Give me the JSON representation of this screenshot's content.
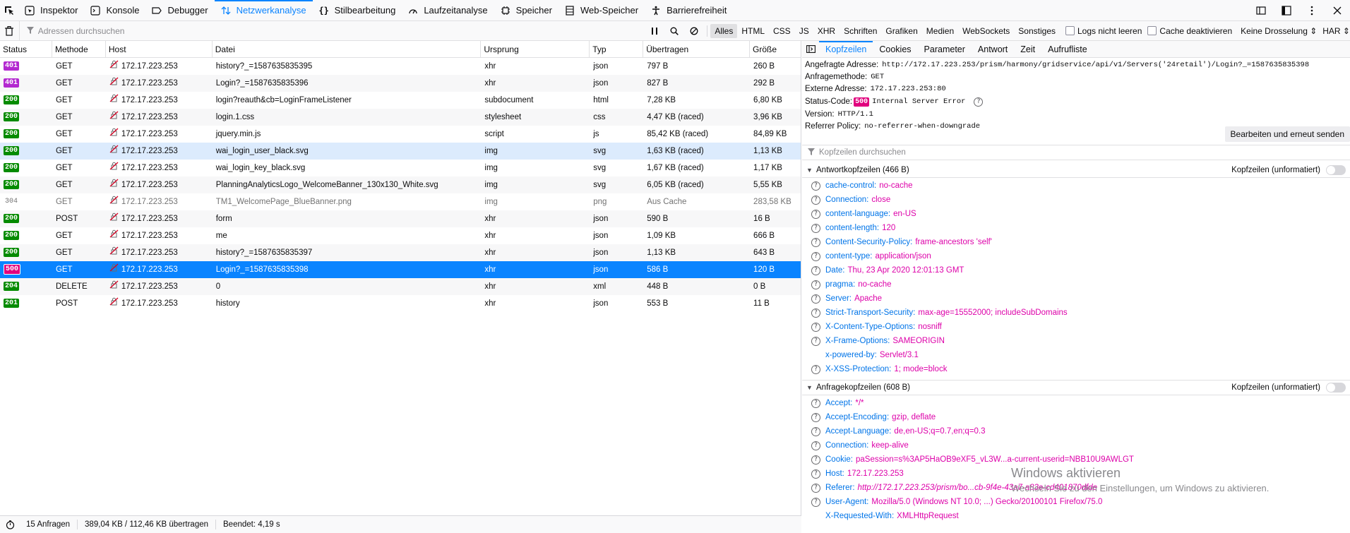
{
  "toolbar": {
    "tabs": [
      {
        "label": "Inspektor",
        "icon": "inspector-icon"
      },
      {
        "label": "Konsole",
        "icon": "console-icon"
      },
      {
        "label": "Debugger",
        "icon": "debugger-icon"
      },
      {
        "label": "Netzwerkanalyse",
        "icon": "network-icon",
        "selected": true
      },
      {
        "label": "Stilbearbeitung",
        "icon": "style-editor-icon"
      },
      {
        "label": "Laufzeitanalyse",
        "icon": "performance-icon"
      },
      {
        "label": "Speicher",
        "icon": "memory-icon"
      },
      {
        "label": "Web-Speicher",
        "icon": "storage-icon"
      },
      {
        "label": "Barrierefreiheit",
        "icon": "accessibility-icon"
      }
    ]
  },
  "filterbar": {
    "placeholder": "Adressen durchsuchen",
    "types": [
      "Alles",
      "HTML",
      "CSS",
      "JS",
      "XHR",
      "Schriften",
      "Grafiken",
      "Medien",
      "WebSockets",
      "Sonstiges"
    ],
    "active_type": "Alles",
    "persist_logs": "Logs nicht leeren",
    "disable_cache": "Cache deaktivieren",
    "throttling": "Keine Drosselung ⇕",
    "har": "HAR ⇕"
  },
  "table": {
    "columns": [
      "Status",
      "Methode",
      "Host",
      "Datei",
      "Ursprung",
      "Typ",
      "Übertragen",
      "Größe"
    ],
    "rows": [
      {
        "status": "401",
        "method": "GET",
        "host": "172.17.223.253",
        "file": "history?_=1587635835395",
        "origin": "xhr",
        "type": "json",
        "transferred": "797 B",
        "size": "260 B"
      },
      {
        "status": "401",
        "method": "GET",
        "host": "172.17.223.253",
        "file": "Login?_=1587635835396",
        "origin": "xhr",
        "type": "json",
        "transferred": "827 B",
        "size": "292 B"
      },
      {
        "status": "200",
        "method": "GET",
        "host": "172.17.223.253",
        "file": "login?reauth&cb=LoginFrameListener",
        "origin": "subdocument",
        "type": "html",
        "transferred": "7,28 KB",
        "size": "6,80 KB"
      },
      {
        "status": "200",
        "method": "GET",
        "host": "172.17.223.253",
        "file": "login.1.css",
        "origin": "stylesheet",
        "type": "css",
        "transferred": "4,47 KB (raced)",
        "size": "3,96 KB"
      },
      {
        "status": "200",
        "method": "GET",
        "host": "172.17.223.253",
        "file": "jquery.min.js",
        "origin": "script",
        "type": "js",
        "transferred": "85,42 KB (raced)",
        "size": "84,89 KB"
      },
      {
        "status": "200",
        "method": "GET",
        "host": "172.17.223.253",
        "file": "wai_login_user_black.svg",
        "origin": "img",
        "type": "svg",
        "transferred": "1,63 KB (raced)",
        "size": "1,13 KB",
        "highlight": true
      },
      {
        "status": "200",
        "method": "GET",
        "host": "172.17.223.253",
        "file": "wai_login_key_black.svg",
        "origin": "img",
        "type": "svg",
        "transferred": "1,67 KB (raced)",
        "size": "1,17 KB"
      },
      {
        "status": "200",
        "method": "GET",
        "host": "172.17.223.253",
        "file": "PlanningAnalyticsLogo_WelcomeBanner_130x130_White.svg",
        "origin": "img",
        "type": "svg",
        "transferred": "6,05 KB (raced)",
        "size": "5,55 KB"
      },
      {
        "status": "304",
        "method": "GET",
        "host": "172.17.223.253",
        "file": "TM1_WelcomePage_BlueBanner.png",
        "origin": "img",
        "type": "png",
        "transferred": "Aus Cache",
        "size": "283,58 KB",
        "cached": true
      },
      {
        "status": "200",
        "method": "POST",
        "host": "172.17.223.253",
        "file": "form",
        "origin": "xhr",
        "type": "json",
        "transferred": "590 B",
        "size": "16 B"
      },
      {
        "status": "200",
        "method": "GET",
        "host": "172.17.223.253",
        "file": "me",
        "origin": "xhr",
        "type": "json",
        "transferred": "1,09 KB",
        "size": "666 B"
      },
      {
        "status": "200",
        "method": "GET",
        "host": "172.17.223.253",
        "file": "history?_=1587635835397",
        "origin": "xhr",
        "type": "json",
        "transferred": "1,13 KB",
        "size": "643 B"
      },
      {
        "status": "500",
        "method": "GET",
        "host": "172.17.223.253",
        "file": "Login?_=1587635835398",
        "origin": "xhr",
        "type": "json",
        "transferred": "586 B",
        "size": "120 B",
        "selected": true
      },
      {
        "status": "204",
        "method": "DELETE",
        "host": "172.17.223.253",
        "file": "0",
        "origin": "xhr",
        "type": "xml",
        "transferred": "448 B",
        "size": "0 B"
      },
      {
        "status": "201",
        "method": "POST",
        "host": "172.17.223.253",
        "file": "history",
        "origin": "xhr",
        "type": "json",
        "transferred": "553 B",
        "size": "11 B"
      }
    ]
  },
  "statusbar": {
    "requests": "15 Anfragen",
    "transferred": "389,04 KB / 112,46 KB übertragen",
    "finished": "Beendet: 4,19 s"
  },
  "details": {
    "tabs": [
      "Kopfzeilen",
      "Cookies",
      "Parameter",
      "Antwort",
      "Zeit",
      "Aufrufliste"
    ],
    "active_tab": "Kopfzeilen",
    "summary": {
      "url_label": "Angefragte Adresse:",
      "url": "http://172.17.223.253/prism/harmony/gridservice/api/v1/Servers('24retail')/Login?_=1587635835398",
      "method_label": "Anfragemethode:",
      "method": "GET",
      "remote_label": "Externe Adresse:",
      "remote": "172.17.223.253:80",
      "status_label": "Status-Code:",
      "status_code": "500",
      "status_text": "Internal Server Error",
      "version_label": "Version:",
      "version": "HTTP/1.1",
      "referrer_label": "Referrer Policy:",
      "referrer": "no-referrer-when-downgrade"
    },
    "resend_label": "Bearbeiten und erneut senden",
    "filter_placeholder": "Kopfzeilen durchsuchen",
    "response_section": {
      "title": "Antwortkopfzeilen (466 B)",
      "raw_label": "Kopfzeilen (unformatiert)"
    },
    "response_headers": [
      {
        "k": "cache-control:",
        "v": "no-cache",
        "help": true
      },
      {
        "k": "Connection:",
        "v": "close",
        "help": true
      },
      {
        "k": "content-language:",
        "v": "en-US",
        "help": true
      },
      {
        "k": "content-length:",
        "v": "120",
        "help": true
      },
      {
        "k": "Content-Security-Policy:",
        "v": "frame-ancestors 'self'",
        "help": true
      },
      {
        "k": "content-type:",
        "v": "application/json",
        "help": true
      },
      {
        "k": "Date:",
        "v": "Thu, 23 Apr 2020 12:01:13 GMT",
        "help": true
      },
      {
        "k": "pragma:",
        "v": "no-cache",
        "help": true
      },
      {
        "k": "Server:",
        "v": "Apache",
        "help": true
      },
      {
        "k": "Strict-Transport-Security:",
        "v": "max-age=15552000; includeSubDomains",
        "help": true
      },
      {
        "k": "X-Content-Type-Options:",
        "v": "nosniff",
        "help": true
      },
      {
        "k": "X-Frame-Options:",
        "v": "SAMEORIGIN",
        "help": true
      },
      {
        "k": "x-powered-by:",
        "v": "Servlet/3.1",
        "help": false
      },
      {
        "k": "X-XSS-Protection:",
        "v": "1; mode=block",
        "help": true
      }
    ],
    "request_section": {
      "title": "Anfragekopfzeilen (608 B)",
      "raw_label": "Kopfzeilen (unformatiert)"
    },
    "request_headers": [
      {
        "k": "Accept:",
        "v": "*/*",
        "help": true
      },
      {
        "k": "Accept-Encoding:",
        "v": "gzip, deflate",
        "help": true
      },
      {
        "k": "Accept-Language:",
        "v": "de,en-US;q=0.7,en;q=0.3",
        "help": true
      },
      {
        "k": "Connection:",
        "v": "keep-alive",
        "help": true
      },
      {
        "k": "Cookie:",
        "v": "paSession=s%3AP5HaOB9eXF5_vL3W...a-current-userid=NBB10U9AWLGT",
        "help": true
      },
      {
        "k": "Host:",
        "v": "172.17.223.253",
        "help": true
      },
      {
        "k": "Referer:",
        "v": "http://172.17.223.253/prism/bo...cb-9f4e-43a7-a83e-cd401870dfde",
        "help": true,
        "italic": true
      },
      {
        "k": "User-Agent:",
        "v": "Mozilla/5.0 (Windows NT 10.0; ...) Gecko/20100101 Firefox/75.0",
        "help": true
      },
      {
        "k": "X-Requested-With:",
        "v": "XMLHttpRequest",
        "help": false
      }
    ]
  },
  "watermark": {
    "title": "Windows aktivieren",
    "subtitle": "Wechseln Sie zu den Einstellungen, um Windows zu aktivieren."
  },
  "colors": {
    "accent": "#0a84ff",
    "status_401": "#b329d0",
    "status_200": "#058b00",
    "status_500": "#e1007e",
    "header_key": "#0074e8",
    "header_value": "#dd00a9"
  }
}
